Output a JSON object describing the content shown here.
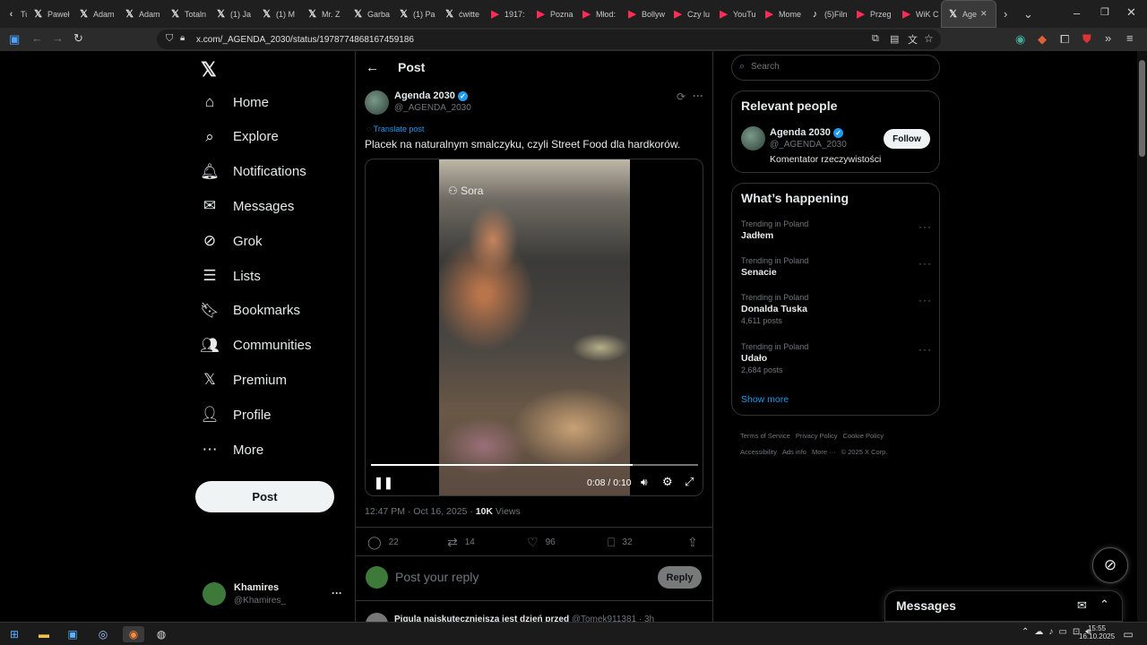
{
  "browser": {
    "tabs": [
      {
        "label": "Tu",
        "icon": "back-arrow-icon"
      },
      {
        "label": "Paweł",
        "icon": "x-logo-icon"
      },
      {
        "label": "Adam",
        "icon": "x-logo-icon"
      },
      {
        "label": "Adam",
        "icon": "x-logo-icon"
      },
      {
        "label": "Totaln",
        "icon": "x-logo-icon"
      },
      {
        "label": "(1) Ja",
        "icon": "x-logo-icon"
      },
      {
        "label": "(1) M",
        "icon": "x-logo-icon"
      },
      {
        "label": "Mr. Z",
        "icon": "x-logo-icon"
      },
      {
        "label": "Garba",
        "icon": "x-logo-icon"
      },
      {
        "label": "(1) Pa",
        "icon": "x-logo-icon"
      },
      {
        "label": "ćwitte",
        "icon": "x-logo-icon"
      },
      {
        "label": "1917:",
        "icon": "youtube-icon"
      },
      {
        "label": "Pozna",
        "icon": "youtube-icon"
      },
      {
        "label": "Młod:",
        "icon": "youtube-icon"
      },
      {
        "label": "Bollyw",
        "icon": "youtube-icon"
      },
      {
        "label": "Czy lu",
        "icon": "youtube-icon"
      },
      {
        "label": "YouTu",
        "icon": "youtube-icon"
      },
      {
        "label": "Mome",
        "icon": "youtube-icon"
      },
      {
        "label": "(5)Filn",
        "icon": "tiktok-icon"
      },
      {
        "label": "Przeg",
        "icon": "youtube-icon"
      },
      {
        "label": "WiK C",
        "icon": "youtube-icon"
      },
      {
        "label": "Age",
        "icon": "x-logo-icon",
        "active": true
      }
    ],
    "url": "x.com/_AGENDA_2030/status/1978774868167459186"
  },
  "nav": {
    "items": [
      "Home",
      "Explore",
      "Notifications",
      "Messages",
      "Grok",
      "Lists",
      "Bookmarks",
      "Communities",
      "Premium",
      "Profile",
      "More"
    ],
    "post_label": "Post"
  },
  "account": {
    "name": "Khamires",
    "handle": "@Khamires_"
  },
  "header": {
    "title": "Post"
  },
  "post": {
    "author_name": "Agenda 2030",
    "author_handle": "@_AGENDA_2030",
    "translate": "Translate post",
    "text": "Placek na naturalnym smalczyku, czyli Street Food dla hardkorów.",
    "video_watermark": "Sora",
    "video_time": "0:08 / 0:10",
    "video_progress": 0.8,
    "timestamp": "12:47 PM · Oct 16, 2025 · ",
    "views_count": "10K",
    "views_label": " Views",
    "replies": "22",
    "reposts": "14",
    "likes": "96",
    "bookmarks": "32"
  },
  "reply": {
    "placeholder": "Post your reply",
    "button": "Reply"
  },
  "next_post": {
    "text": "Pigula najskuteczniejsza jest dzień przed",
    "handle": "@Tomek911381 · 3h"
  },
  "search": {
    "placeholder": "Search"
  },
  "relevant": {
    "title": "Relevant people",
    "name": "Agenda 2030",
    "handle": "@_AGENDA_2030",
    "bio": "Komentator rzeczywistości",
    "follow": "Follow"
  },
  "happening": {
    "title": "What’s happening",
    "trends": [
      {
        "context": "Trending in Poland",
        "name": "Jadłem",
        "posts": ""
      },
      {
        "context": "Trending in Poland",
        "name": "Senacie",
        "posts": ""
      },
      {
        "context": "Trending in Poland",
        "name": "Donalda Tuska",
        "posts": "4,611 posts"
      },
      {
        "context": "Trending in Poland",
        "name": "Udało",
        "posts": "2,684 posts"
      }
    ],
    "show_more": "Show more"
  },
  "footer": {
    "links": [
      "Terms of Service",
      "Privacy Policy",
      "Cookie Policy",
      "Accessibility",
      "Ads info",
      "More ···",
      "© 2025 X Corp."
    ]
  },
  "messages": {
    "title": "Messages"
  },
  "taskbar": {
    "time": "15:55",
    "date": "16.10.2025"
  },
  "colors": {
    "accent": "#1d9bf0",
    "background": "#000000",
    "border": "#2f3336"
  }
}
